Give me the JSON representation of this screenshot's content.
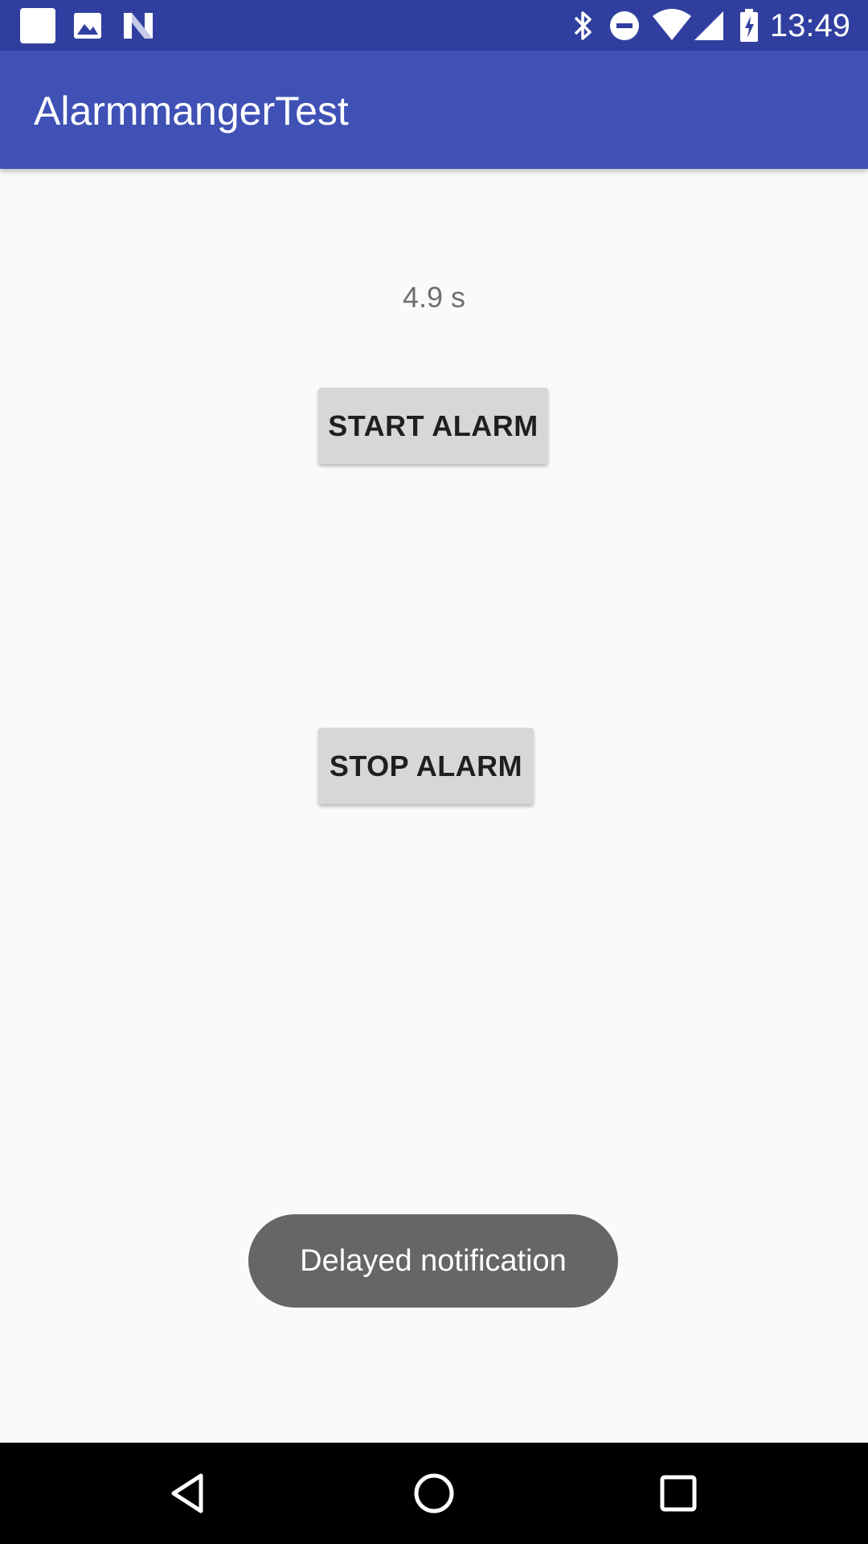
{
  "status_bar": {
    "time": "13:49",
    "icons": [
      "notification-square-icon",
      "image-icon",
      "n-logo-icon",
      "bluetooth-icon",
      "do-not-disturb-icon",
      "wifi-icon",
      "cell-signal-icon",
      "battery-charging-icon"
    ]
  },
  "app_bar": {
    "title": "AlarmmangerTest"
  },
  "main": {
    "timer_text": "4.9 s",
    "start_button_label": "START ALARM",
    "stop_button_label": "STOP ALARM"
  },
  "toast": {
    "message": "Delayed notification"
  },
  "nav_bar": {
    "icons": [
      "back-icon",
      "home-icon",
      "recents-icon"
    ]
  },
  "colors": {
    "status_bar": "#303f9f",
    "app_bar": "#3f51b5",
    "background": "#fafafa",
    "button": "#d6d7d7",
    "toast": "#666666"
  }
}
